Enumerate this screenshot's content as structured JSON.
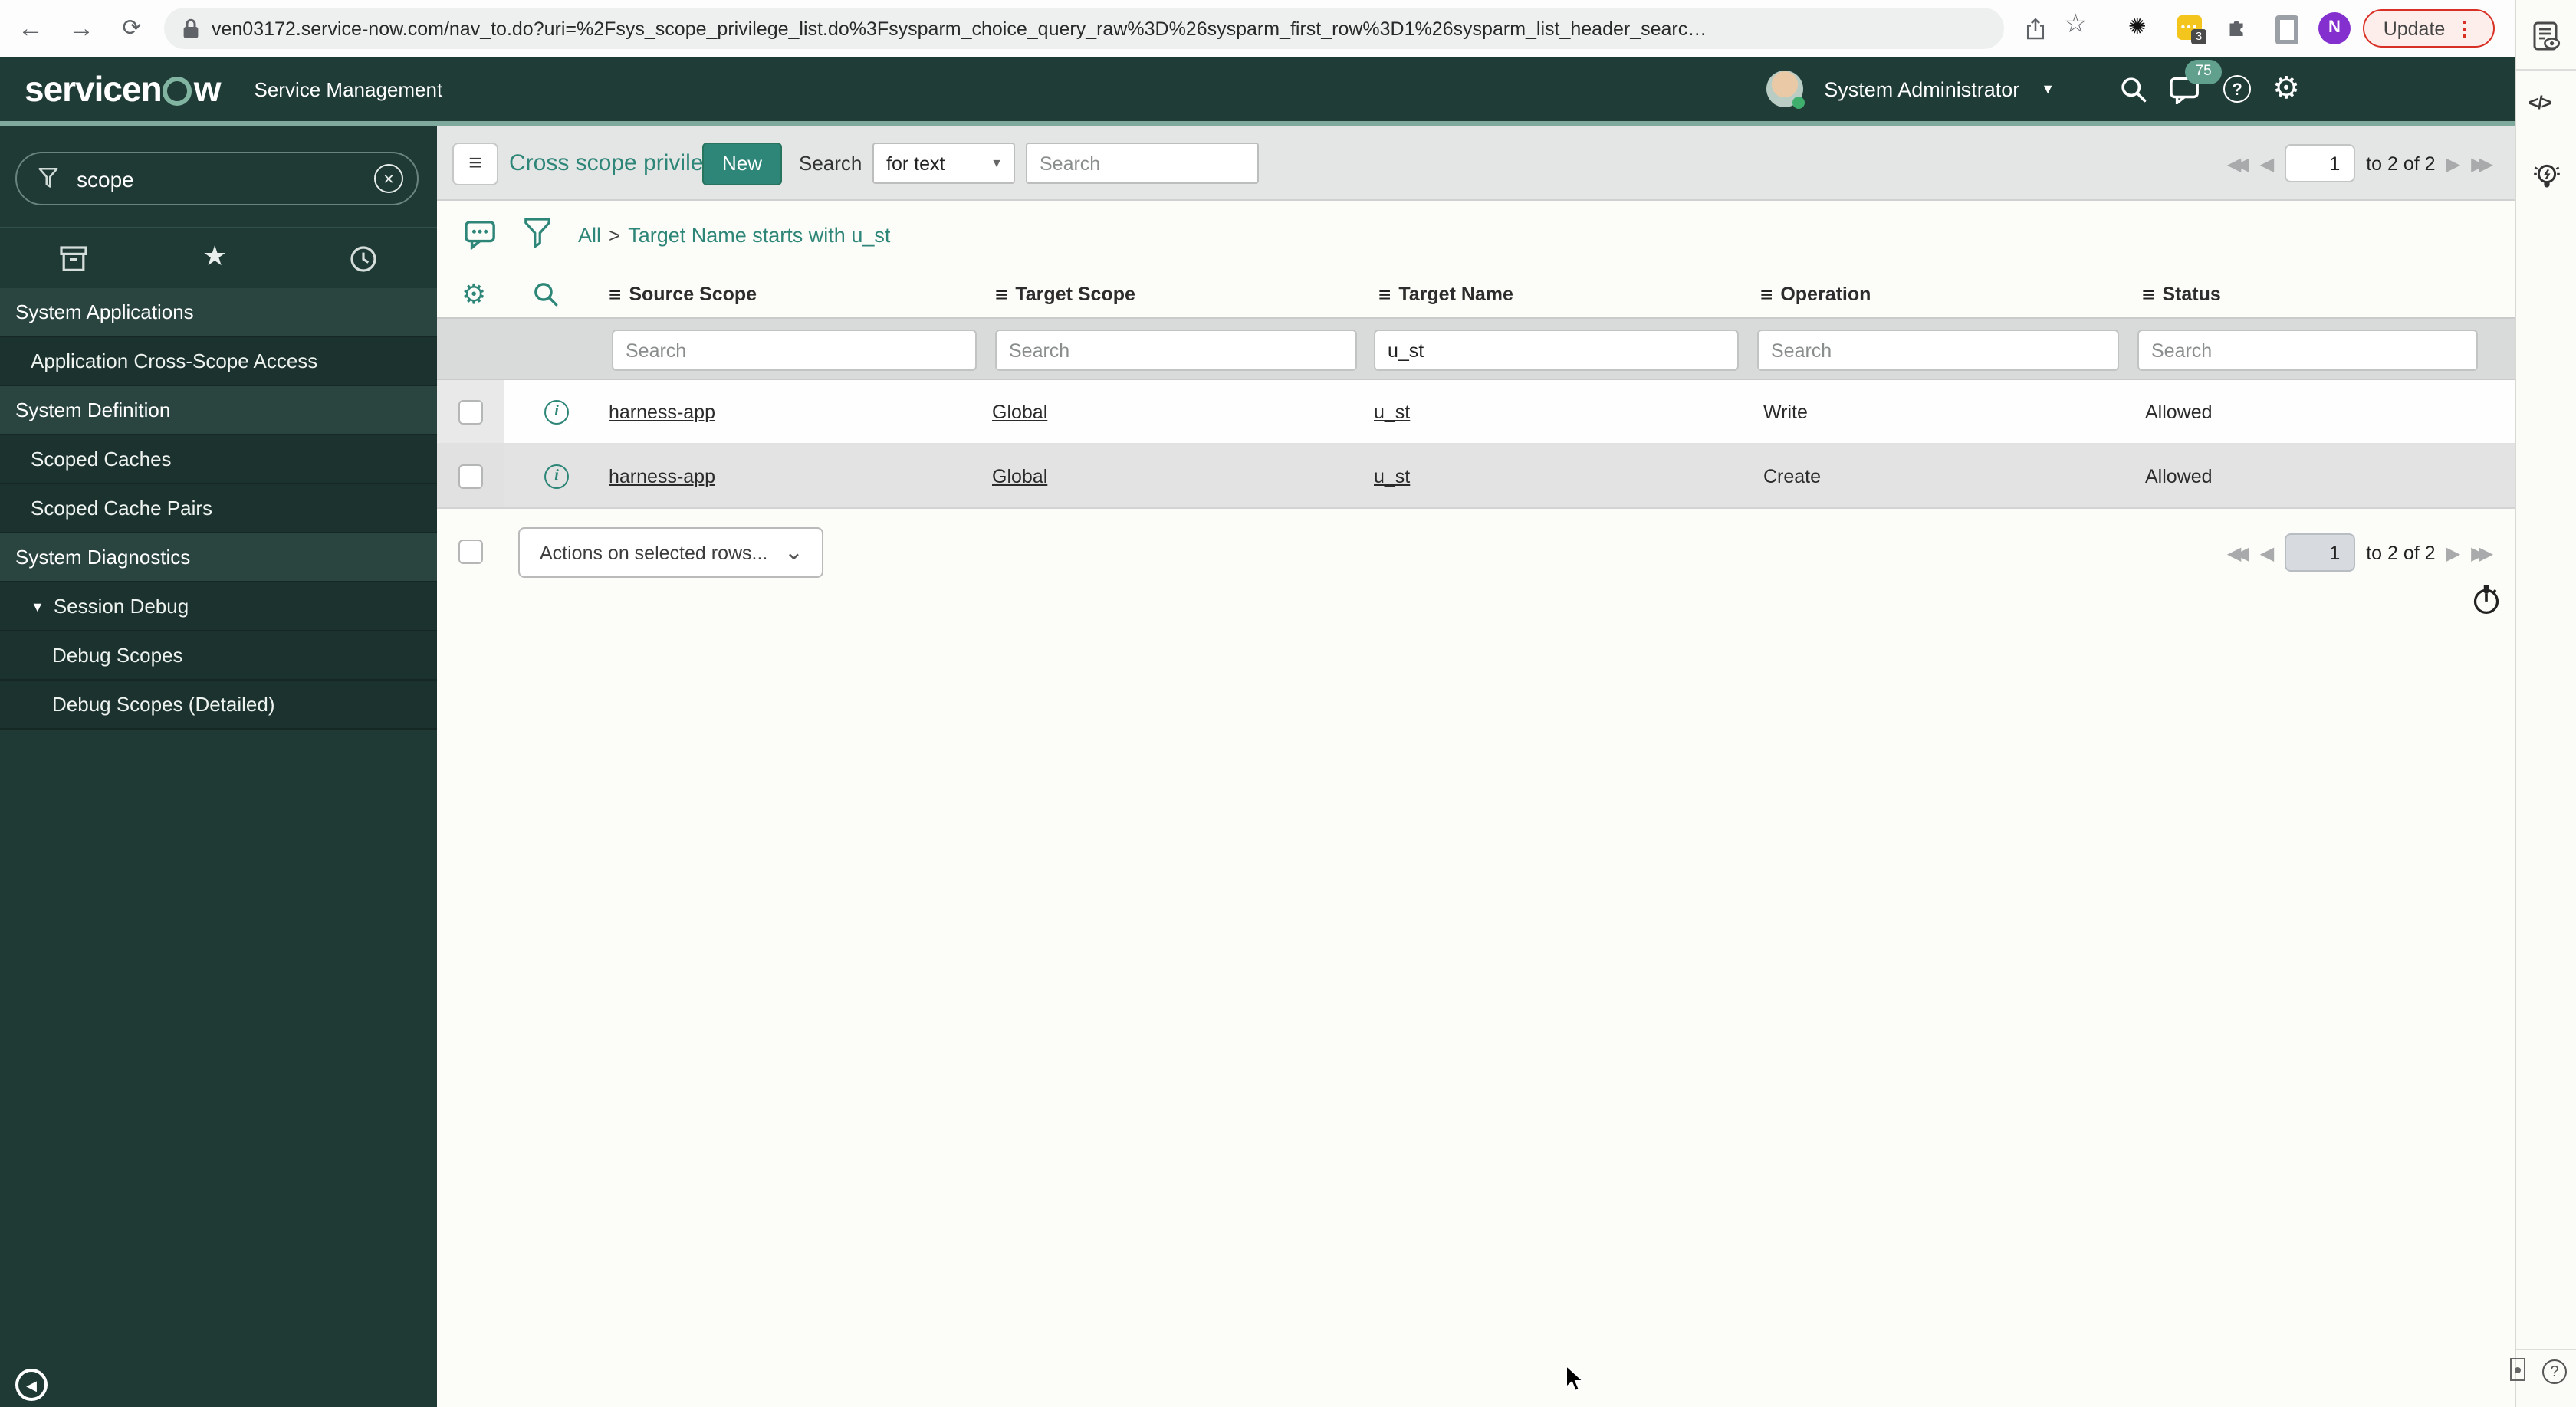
{
  "colors": {
    "accent_teal": "#2e8678",
    "header_bg": "#203c37",
    "update_red": "#d93025",
    "badge_green": "#61a08c",
    "extension_yellow": "#f4c51d",
    "avatar_purple": "#8430ce"
  },
  "browser": {
    "url": "ven03172.service-now.com/nav_to.do?uri=%2Fsys_scope_privilege_list.do%3Fsysparm_choice_query_raw%3D%26sysparm_first_row%3D1%26sysparm_list_header_searc…",
    "update_label": "Update",
    "extension_badge": "3",
    "avatar_letter": "N"
  },
  "app_header": {
    "logo_pre": "servicen",
    "logo_post": "w",
    "product": "Service Management",
    "user": "System Administrator",
    "notification_badge": "75"
  },
  "sidebar": {
    "search_value": "scope",
    "items": [
      {
        "label": "System Applications"
      },
      {
        "label": "Application Cross-Scope Access"
      },
      {
        "label": "System Definition"
      },
      {
        "label": "Scoped Caches"
      },
      {
        "label": "Scoped Cache Pairs"
      },
      {
        "label": "System Diagnostics"
      },
      {
        "label": "Session Debug"
      },
      {
        "label": "Debug Scopes"
      },
      {
        "label": "Debug Scopes (Detailed)"
      }
    ]
  },
  "toolbar": {
    "title": "Cross scope privileges",
    "new_label": "New",
    "search_label": "Search",
    "search_type": "for text",
    "search_placeholder": "Search"
  },
  "pagination": {
    "page": "1",
    "range": "to 2 of 2"
  },
  "breadcrumb": {
    "root": "All",
    "separator": ">",
    "condition": "Target Name starts with u_st"
  },
  "list": {
    "columns": [
      "Source Scope",
      "Target Scope",
      "Target Name",
      "Operation",
      "Status"
    ],
    "filter_placeholder": "Search",
    "filters": [
      "",
      "",
      "u_st",
      "",
      ""
    ],
    "rows": [
      {
        "source_scope": "harness-app",
        "target_scope": "Global",
        "target_name": "u_st",
        "operation": "Write",
        "status": "Allowed"
      },
      {
        "source_scope": "harness-app",
        "target_scope": "Global",
        "target_name": "u_st",
        "operation": "Create",
        "status": "Allowed"
      }
    ],
    "actions_label": "Actions on selected rows..."
  }
}
